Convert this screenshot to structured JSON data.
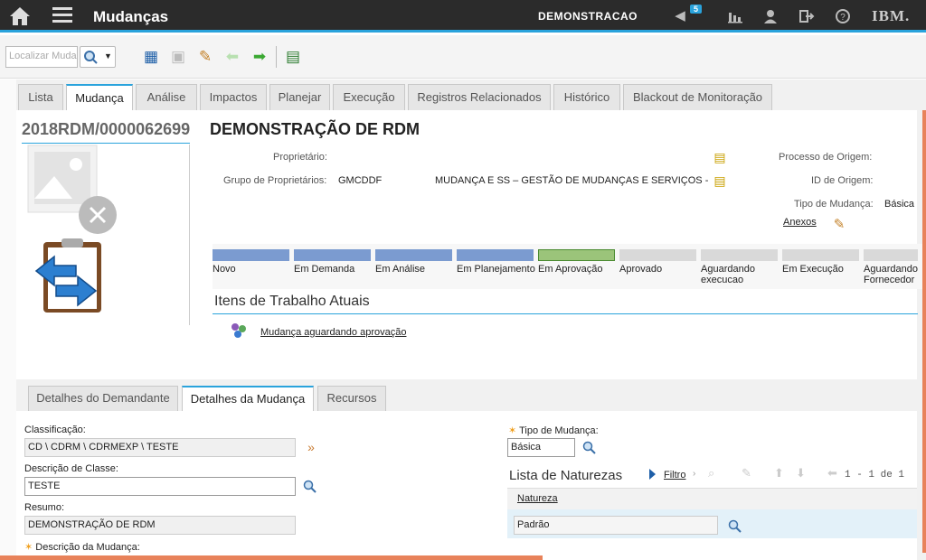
{
  "header": {
    "title": "Mudanças",
    "org": "DEMONSTRACAO",
    "notifications": "5",
    "brand": "IBM."
  },
  "toolbar": {
    "search_placeholder": "Localizar Muda"
  },
  "tabs": [
    "Lista",
    "Mudança",
    "Análise",
    "Impactos",
    "Planejar",
    "Execução",
    "Registros Relacionados",
    "Histórico",
    "Blackout de Monitoração"
  ],
  "record": {
    "id": "2018RDM/0000062699",
    "description": "DEMONSTRAÇÃO DE RDM"
  },
  "fields": {
    "owner_label": "Proprietário:",
    "owner_group_label": "Grupo de Proprietários:",
    "owner_group_value": "GMCDDF",
    "owner_group_desc": "MUDANÇA E SS – GESTÃO DE MUDANÇAS E SERVIÇOS -",
    "origin_process_label": "Processo de Origem:",
    "origin_id_label": "ID de Origem:",
    "change_type_label": "Tipo de Mudança:",
    "change_type_value": "Básica",
    "attachments": "Anexos"
  },
  "statuses": [
    {
      "label": "Novo",
      "color": "#7b9bd0"
    },
    {
      "label": "Em Demanda",
      "color": "#7b9bd0"
    },
    {
      "label": "Em Análise",
      "color": "#7b9bd0"
    },
    {
      "label": "Em Planejamento",
      "color": "#7b9bd0"
    },
    {
      "label": "Em Aprovação",
      "color": "#9bc47a"
    },
    {
      "label": "Aprovado",
      "color": "#d9d9d9"
    },
    {
      "label": "Aguardando execucao",
      "color": "#d9d9d9"
    },
    {
      "label": "Em Execução",
      "color": "#d9d9d9"
    },
    {
      "label": "Aguardando Fornecedor",
      "color": "#d9d9d9"
    }
  ],
  "work_items": {
    "title": "Itens de Trabalho Atuais",
    "item": "Mudança aguardando aprovação"
  },
  "subtabs": [
    "Detalhes do Demandante",
    "Detalhes da Mudança",
    "Recursos"
  ],
  "details": {
    "classification_label": "Classificação:",
    "classification_value": "CD \\ CDRM \\ CDRMEXP \\ TESTE",
    "class_desc_label": "Descrição de Classe:",
    "class_desc_value": "TESTE",
    "summary_label": "Resumo:",
    "summary_value": "DEMONSTRAÇÃO DE RDM",
    "change_desc_label": "Descrição da Mudança:",
    "type_label": "Tipo de Mudança:",
    "type_value": "Básica",
    "nature_title": "Lista de Naturezas",
    "filter": "Filtro",
    "pagination": "1 - 1 de 1",
    "nature_col": "Natureza",
    "nature_value": "Padrão"
  }
}
